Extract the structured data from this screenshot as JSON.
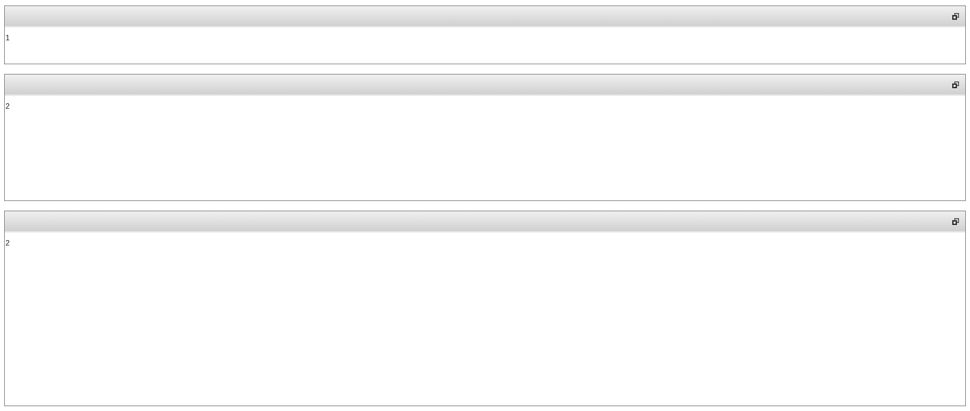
{
  "panels": [
    {
      "content": "1"
    },
    {
      "content": "2"
    },
    {
      "content": "2"
    }
  ]
}
